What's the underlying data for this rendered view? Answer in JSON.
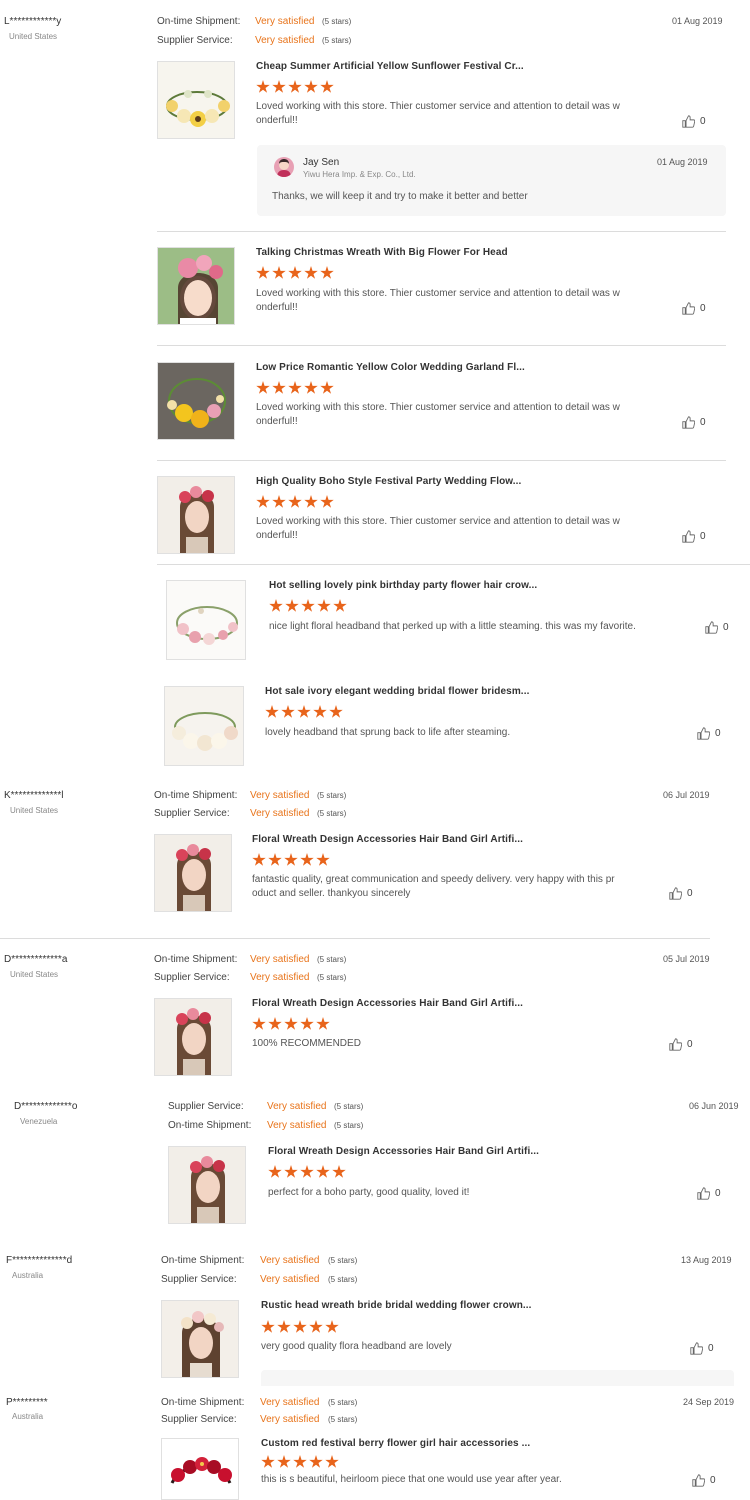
{
  "labels": {
    "shipment": "On-time Shipment:",
    "service": "Supplier Service:",
    "rating": "Very satisfied",
    "stars": "(5 stars)"
  },
  "reviews": [
    {
      "buyer": "L************y",
      "country": "United States",
      "date": "01 Aug 2019",
      "items": [
        {
          "title": "Cheap Summer Artificial Yellow Sunflower Festival Cr...",
          "text": "Loved working with this store. Thier customer service and attention to detail was w onderful!!",
          "likes": "0",
          "reply": {
            "name": "Jay Sen",
            "company": "Yiwu Hera Imp. & Exp. Co., Ltd.",
            "date": "01 Aug 2019",
            "text": "Thanks, we will keep it and try to make it better and better"
          }
        },
        {
          "title": "Talking Christmas Wreath With Big Flower For Head",
          "text": "Loved working with this store. Thier customer service and attention to detail was w onderful!!",
          "likes": "0"
        },
        {
          "title": "Low Price Romantic Yellow Color Wedding Garland Fl...",
          "text": "Loved working with this store. Thier customer service and attention to detail was w onderful!!",
          "likes": "0"
        },
        {
          "title": "High Quality Boho Style Festival Party Wedding Flow...",
          "text": "Loved working with this store. Thier customer service and attention to detail was w onderful!!",
          "likes": "0"
        },
        {
          "title": "Hot selling lovely pink birthday party flower hair crow...",
          "text": "nice light floral headband that perked up with a little steaming. this was my favorite.",
          "likes": "0"
        },
        {
          "title": "Hot sale ivory elegant wedding bridal flower bridesm...",
          "text": "lovely headband that sprung back to life after steaming.",
          "likes": "0"
        }
      ]
    },
    {
      "buyer": "K*************l",
      "country": "United States",
      "date": "06 Jul 2019",
      "items": [
        {
          "title": "Floral Wreath Design Accessories Hair Band Girl Artifi...",
          "text": "fantastic quality, great communication and speedy delivery. very happy with this pr oduct and seller. thankyou sincerely",
          "likes": "0"
        }
      ]
    },
    {
      "buyer": "D*************a",
      "country": "United States",
      "date": "05 Jul 2019",
      "items": [
        {
          "title": "Floral Wreath Design Accessories Hair Band Girl Artifi...",
          "text": "100% RECOMMENDED",
          "likes": "0"
        }
      ]
    },
    {
      "buyer": "D*************o",
      "country": "Venezuela",
      "date": "06 Jun 2019",
      "items": [
        {
          "title": "Floral Wreath Design Accessories Hair Band Girl Artifi...",
          "text": "perfect for a boho party, good quality, loved it!",
          "likes": "0"
        }
      ]
    },
    {
      "buyer": "F**************d",
      "country": "Australia",
      "date": "13 Aug 2019",
      "items": [
        {
          "title": "Rustic head wreath bride bridal wedding flower crown...",
          "text": "very good quality flora headband are lovely",
          "likes": "0"
        }
      ]
    },
    {
      "buyer": "P*********",
      "country": "Australia",
      "date": "24 Sep 2019",
      "items": [
        {
          "title": "Custom red festival berry flower girl hair accessories ...",
          "text": "this is s beautiful, heirloom piece that one would use year after year.",
          "likes": "0"
        }
      ]
    }
  ],
  "colors": {
    "accent": "#e8741b",
    "star": "#e8641b"
  }
}
